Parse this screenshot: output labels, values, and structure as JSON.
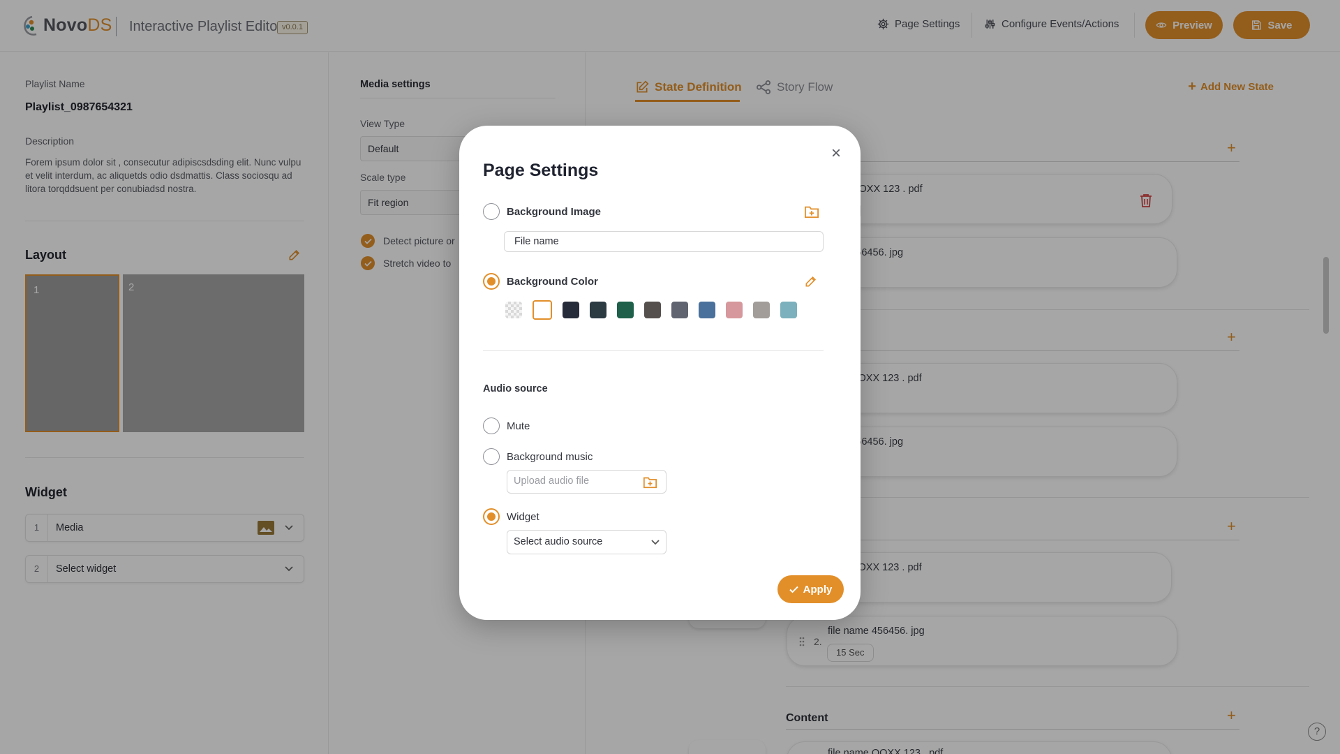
{
  "header": {
    "brand_main": "Novo",
    "brand_accent": "DS",
    "app_title": "Interactive Playlist Editor",
    "version": "v0.0.1",
    "page_settings": "Page Settings",
    "configure_events": "Configure Events/Actions",
    "preview": "Preview",
    "save": "Save"
  },
  "left": {
    "playlist_name_label": "Playlist Name",
    "playlist_name": "Playlist_0987654321",
    "description_label": "Description",
    "description": "Forem ipsum dolor sit , consecutur adipiscsdsding elit. Nunc vulpu et velit interdum, ac aliquetds odio dsdmattis. Class sociosqu ad litora torqddsuent per conubiadsd nostra.",
    "layout_title": "Layout",
    "layout_regions": [
      "1",
      "2"
    ],
    "widget_title": "Widget",
    "widgets": [
      {
        "num": "1",
        "label": "Media"
      },
      {
        "num": "2",
        "label": "Select widget"
      }
    ]
  },
  "middle": {
    "section_title": "Media settings",
    "view_type_label": "View Type",
    "view_type_value": "Default",
    "scale_type_label": "Scale type",
    "scale_type_value": "Fit region",
    "checks": [
      "Detect picture or",
      "Stretch video to"
    ]
  },
  "right": {
    "tab_state_definition": "State Definition",
    "tab_story_flow": "Story Flow",
    "add_new_state": "Add New State",
    "sec_unit": "Sec",
    "cards": [
      {
        "name": "ame OOXX 123 . pdf",
        "duration": ""
      },
      {
        "name": "ame 456456. jpg",
        "duration": ""
      },
      {
        "name": "ame OOXX 123 . pdf",
        "duration": ""
      },
      {
        "name": "ame 456456. jpg",
        "duration": ""
      },
      {
        "name": "ame OOXX 123 . pdf",
        "duration": ""
      },
      {
        "name": "file name 456456. jpg",
        "duration": "15",
        "index": "2."
      },
      {
        "name": "file name OOXX 123 . pdf",
        "duration": ""
      }
    ],
    "content_label": "Content",
    "help": "?"
  },
  "modal": {
    "title": "Page Settings",
    "bg_image_label": "Background Image",
    "file_name_value": "File name",
    "bg_color_label": "Background Color",
    "swatches": [
      "transparent",
      "#ffffff",
      "#272c3a",
      "#2c3a42",
      "#1e6049",
      "#55504d",
      "#5f6470",
      "#4a719b",
      "#d6989c",
      "#a39d99",
      "#7bb0bc"
    ],
    "audio_source_label": "Audio source",
    "mute_label": "Mute",
    "bg_music_label": "Background music",
    "upload_placeholder": "Upload audio file",
    "widget_label": "Widget",
    "select_audio_source": "Select audio source",
    "apply": "Apply"
  },
  "colors": {
    "accent": "#e28f2a",
    "overlay": "rgba(0,0,0,0.35)"
  }
}
